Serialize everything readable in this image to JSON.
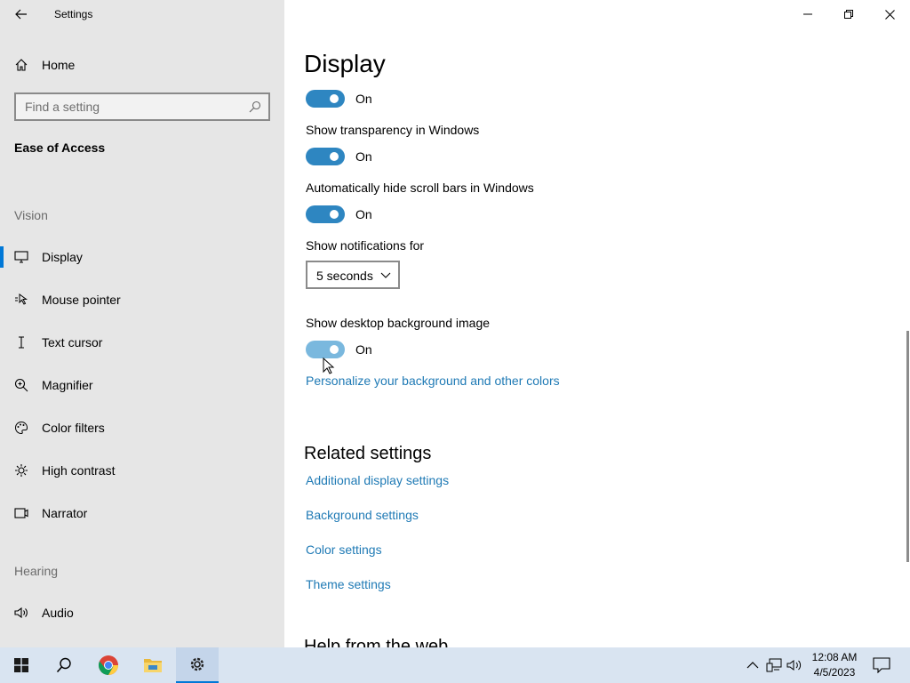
{
  "window": {
    "title": "Settings"
  },
  "sidebar": {
    "home_label": "Home",
    "search_placeholder": "Find a setting",
    "section_title": "Ease of Access",
    "groups": {
      "vision": "Vision",
      "hearing": "Hearing"
    },
    "items": [
      {
        "label": "Display",
        "icon": "monitor-icon",
        "active": true
      },
      {
        "label": "Mouse pointer",
        "icon": "mouse-pointer-icon"
      },
      {
        "label": "Text cursor",
        "icon": "text-cursor-icon"
      },
      {
        "label": "Magnifier",
        "icon": "magnifier-icon"
      },
      {
        "label": "Color filters",
        "icon": "palette-icon"
      },
      {
        "label": "High contrast",
        "icon": "sun-icon"
      },
      {
        "label": "Narrator",
        "icon": "narrator-icon"
      },
      {
        "label": "Audio",
        "icon": "speaker-icon"
      }
    ]
  },
  "main": {
    "page_title": "Display",
    "toggle_top": {
      "state": "On"
    },
    "transparency": {
      "label": "Show transparency in Windows",
      "state": "On"
    },
    "scrollbars": {
      "label": "Automatically hide scroll bars in Windows",
      "state": "On"
    },
    "notifications": {
      "label": "Show notifications for",
      "value": "5 seconds"
    },
    "desktop_bg": {
      "label": "Show desktop background image",
      "state": "On"
    },
    "personalize_link": "Personalize your background and other colors",
    "related": {
      "title": "Related settings",
      "links": [
        "Additional display settings",
        "Background settings",
        "Color settings",
        "Theme settings"
      ]
    },
    "help_title": "Help from the web"
  },
  "taskbar": {
    "time": "12:08 AM",
    "date": "4/5/2023",
    "accent": "#0078d7"
  }
}
